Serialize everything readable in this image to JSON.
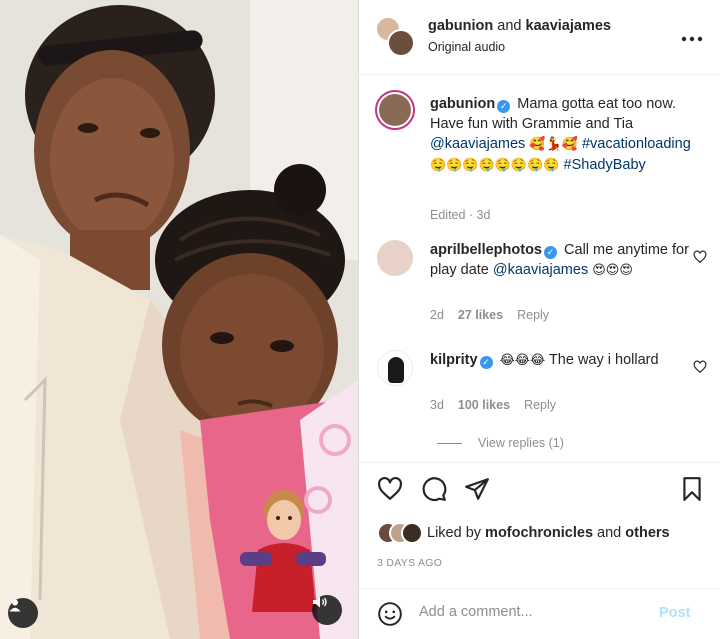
{
  "post": {
    "header": {
      "user1": "gabunion",
      "and_word": "and",
      "user2": "kaaviajames",
      "subtitle": "Original audio",
      "more_icon": "more-horizontal-icon"
    },
    "caption": {
      "username": "gabunion",
      "line1": "Mama gotta eat too now. Have fun with Grammie and Tia",
      "mention": "@kaaviajames",
      "emojis1": "🥰💃🥰",
      "hashtag1": "#vacationloading",
      "emojis2": "🤤🤤🤤🤤🤤🤤🤤🤤",
      "hashtag2": "#ShadyBaby",
      "meta": "Edited · 3d"
    },
    "comments": [
      {
        "username": "aprilbellephotos",
        "text": "Call me anytime for play date",
        "mention": "@kaaviajames",
        "emojis": "😍😍😍",
        "age": "2d",
        "likes": "27 likes",
        "reply": "Reply"
      },
      {
        "username": "kilprity",
        "emojis": "😂😂😂",
        "text": "The way i hollard",
        "age": "3d",
        "likes": "100 likes",
        "reply": "Reply"
      }
    ],
    "view_replies": "View replies (1)",
    "liked_by": {
      "prefix": "Liked by",
      "user": "mofochronicles",
      "and_word": "and",
      "others": "others"
    },
    "date": "3 DAYS AGO",
    "add_comment": {
      "placeholder": "Add a comment...",
      "post_label": "Post"
    }
  },
  "colors": {
    "link": "#00376b",
    "verified": "#3897f0",
    "muted": "#8e8e8e",
    "post_disabled": "#b2dffc"
  }
}
